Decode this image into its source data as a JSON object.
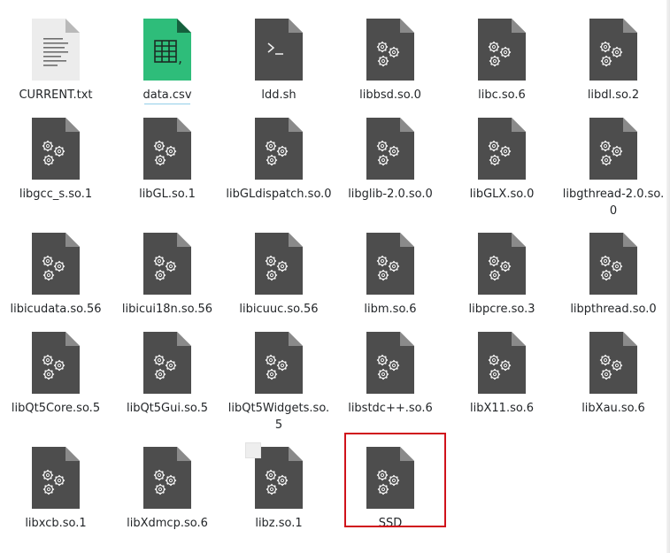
{
  "files": [
    {
      "name": "CURRENT.txt",
      "icon": "text-file-icon"
    },
    {
      "name": "data.csv",
      "icon": "spreadsheet-icon",
      "underlined": true
    },
    {
      "name": "ldd.sh",
      "icon": "script-icon"
    },
    {
      "name": "libbsd.so.0",
      "icon": "library-gears-icon"
    },
    {
      "name": "libc.so.6",
      "icon": "library-gears-icon"
    },
    {
      "name": "libdl.so.2",
      "icon": "library-gears-icon"
    },
    {
      "name": "libgcc_s.so.1",
      "icon": "library-gears-icon"
    },
    {
      "name": "libGL.so.1",
      "icon": "library-gears-icon"
    },
    {
      "name": "libGLdispatch.so.0",
      "icon": "library-gears-icon"
    },
    {
      "name": "libglib-2.0.so.0",
      "icon": "library-gears-icon"
    },
    {
      "name": "libGLX.so.0",
      "icon": "library-gears-icon"
    },
    {
      "name": "libgthread-2.0.so.0",
      "icon": "library-gears-icon"
    },
    {
      "name": "libicudata.so.56",
      "icon": "library-gears-icon"
    },
    {
      "name": "libicui18n.so.56",
      "icon": "library-gears-icon"
    },
    {
      "name": "libicuuc.so.56",
      "icon": "library-gears-icon"
    },
    {
      "name": "libm.so.6",
      "icon": "library-gears-icon"
    },
    {
      "name": "libpcre.so.3",
      "icon": "library-gears-icon"
    },
    {
      "name": "libpthread.so.0",
      "icon": "library-gears-icon"
    },
    {
      "name": "libQt5Core.so.5",
      "icon": "library-gears-icon"
    },
    {
      "name": "libQt5Gui.so.5",
      "icon": "library-gears-icon"
    },
    {
      "name": "libQt5Widgets.so.5",
      "icon": "library-gears-icon"
    },
    {
      "name": "libstdc++.so.6",
      "icon": "library-gears-icon"
    },
    {
      "name": "libX11.so.6",
      "icon": "library-gears-icon"
    },
    {
      "name": "libXau.so.6",
      "icon": "library-gears-icon"
    },
    {
      "name": "libxcb.so.1",
      "icon": "library-gears-icon"
    },
    {
      "name": "libXdmcp.so.6",
      "icon": "library-gears-icon"
    },
    {
      "name": "libz.so.1",
      "icon": "library-gears-icon"
    },
    {
      "name": "SSD",
      "icon": "library-gears-icon",
      "highlighted": true
    }
  ],
  "colors": {
    "doc_dark": "#4d4d4d",
    "doc_fold_dark": "#8a8a8a",
    "sheet_green": "#2ebd7a",
    "text_doc": "#f2f2f2",
    "highlight_border": "#d0121b"
  }
}
